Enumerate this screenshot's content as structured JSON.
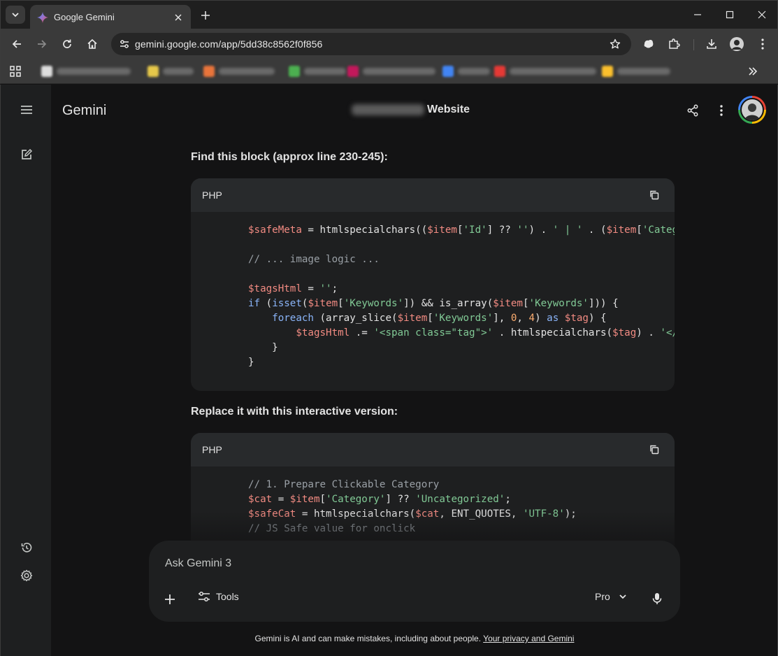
{
  "browser": {
    "tab_title": "Google Gemini",
    "url": "gemini.google.com/app/5dd38c8562f0f856",
    "bookmark_count": 9
  },
  "app": {
    "brand": "Gemini",
    "conversation_title_suffix": "Website"
  },
  "content": {
    "heading_1": "Find this block (approx line 230-245):",
    "code_1_lang": "PHP",
    "heading_2": "Replace it with this interactive version:",
    "code_2_lang": "PHP",
    "code_1_lines": [
      "$safeMeta = htmlspecialchars(($item['Id'] ?? '') . ' | ' . ($item['Catego",
      "",
      "// ... image logic ...",
      "",
      "$tagsHtml = '';",
      "if (isset($item['Keywords']) && is_array($item['Keywords'])) {",
      "    foreach (array_slice($item['Keywords'], 0, 4) as $tag) {",
      "        $tagsHtml .= '<span class=\"tag\">' . htmlspecialchars($tag) . '</s",
      "    }",
      "}"
    ],
    "code_2_lines": [
      "// 1. Prepare Clickable Category",
      "$cat = $item['Category'] ?? 'Uncategorized';",
      "$safeCat = htmlspecialchars($cat, ENT_QUOTES, 'UTF-8');",
      "// JS Safe value for onclick"
    ]
  },
  "composer": {
    "placeholder": "Ask Gemini 3",
    "tools_label": "Tools",
    "model_label": "Pro"
  },
  "footer": {
    "disclaimer": "Gemini is AI and can make mistakes, including about people.",
    "link": "Your privacy and Gemini"
  },
  "colors": {
    "background": "#131314",
    "surface": "#1e1f20",
    "code_header": "#282a2c",
    "variable": "#f28b82",
    "string": "#81c995",
    "keyword": "#8ab4f8",
    "number": "#fcad70",
    "comment": "#9aa0a6"
  }
}
